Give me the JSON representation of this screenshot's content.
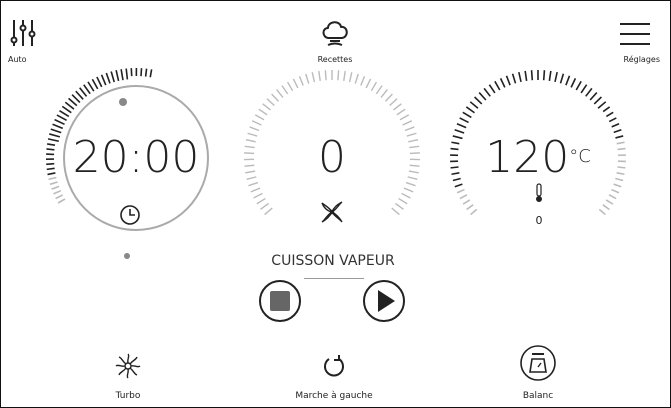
{
  "header": {
    "auto_label": "Auto",
    "recipes_label": "Recettes",
    "settings_label": "Réglages"
  },
  "dials": {
    "timer": {
      "value": "20:00"
    },
    "speed": {
      "value": "0"
    },
    "temperature": {
      "value": "120",
      "unit": "°C",
      "sub_value": "0"
    }
  },
  "program": {
    "title": "CUISSON VAPEUR"
  },
  "footer": {
    "turbo_label": "Turbo",
    "reverse_label": "Marche à gauche",
    "scale_label": "Balanc"
  },
  "icons": {
    "auto": "sliders-icon",
    "recipes": "chef-hat-icon",
    "settings": "hamburger-menu-icon",
    "timer": "clock-icon",
    "speed": "blade-icon",
    "temperature": "thermometer-icon",
    "stop": "stop-icon",
    "play": "play-icon",
    "turbo": "turbo-icon",
    "reverse": "rotate-left-icon",
    "scale": "scale-icon"
  }
}
